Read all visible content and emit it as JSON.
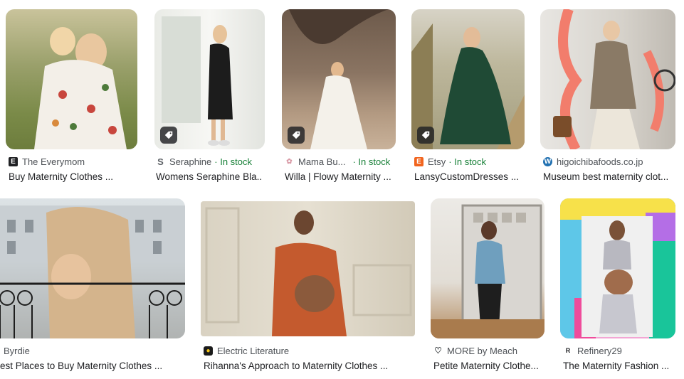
{
  "accent_green": "#188038",
  "results": [
    {
      "source": "The Everymom",
      "title": "Buy Maternity Clothes ...",
      "stock": "",
      "favicon": "E"
    },
    {
      "source": "Seraphine",
      "stock": "· In stock",
      "title": "Womens Seraphine Bla...",
      "favicon": "S"
    },
    {
      "source": "Mama Bu...",
      "stock": "· In stock",
      "title": "Willa | Flowy Maternity ...",
      "favicon": "flower"
    },
    {
      "source": "Etsy",
      "stock": "· In stock",
      "title": "LansyCustomDresses ...",
      "favicon": "E"
    },
    {
      "source": "higoichibafoods.co.jp",
      "stock": "",
      "title": "Museum best maternity clot...",
      "favicon": "wordpress"
    },
    {
      "source": "Byrdie",
      "stock": "",
      "title": "est Places to Buy Maternity Clothes ...",
      "favicon": ""
    },
    {
      "source": "Electric Literature",
      "stock": "",
      "title": "Rihanna's Approach to Maternity Clothes ...",
      "favicon": "bulb"
    },
    {
      "source": "MORE by Meach",
      "stock": "",
      "title": "Petite Maternity Clothe...",
      "favicon": "heart"
    },
    {
      "source": "Refinery29",
      "stock": "",
      "title": "The Maternity Fashion ...",
      "favicon": "R29"
    }
  ]
}
